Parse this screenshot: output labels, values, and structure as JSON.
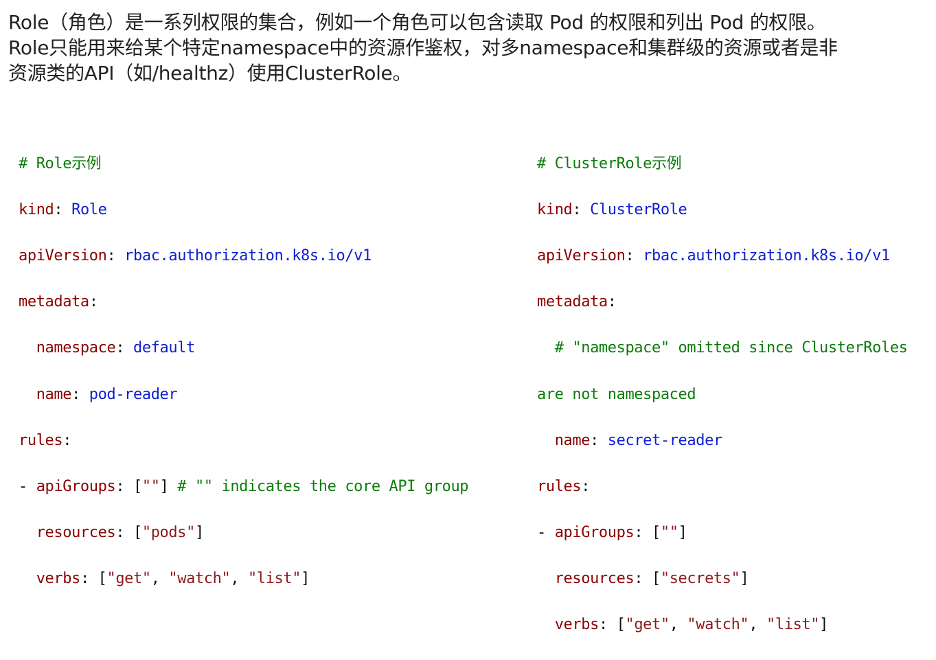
{
  "intro": {
    "line1": "Role（角色）是一系列权限的集合，例如一个角色可以包含读取 Pod 的权限和列出 Pod 的权限。",
    "line2": "Role只能用来给某个特定namespace中的资源作鉴权，对多namespace和集群级的资源或者是非",
    "line3": "资源类的API（如/healthz）使用ClusterRole。"
  },
  "role_example": {
    "comment": "# Role示例",
    "kind_key": "kind",
    "kind_val": "Role",
    "api_key": "apiVersion",
    "api_val": "rbac.authorization.k8s.io/v1",
    "meta_key": "metadata",
    "ns_key": "namespace",
    "ns_val": "default",
    "name_key": "name",
    "name_val": "pod-reader",
    "rules_key": "rules",
    "apigroups_key": "apiGroups",
    "apigroups_val": "\"\"",
    "apigroups_comment": "# \"\" indicates the core API group",
    "resources_key": "resources",
    "resources_val": "\"pods\"",
    "verbs_key": "verbs",
    "verbs": [
      "\"get\"",
      "\"watch\"",
      "\"list\""
    ]
  },
  "clusterrole_example": {
    "comment": "# ClusterRole示例",
    "kind_key": "kind",
    "kind_val": "ClusterRole",
    "api_key": "apiVersion",
    "api_val": "rbac.authorization.k8s.io/v1",
    "meta_key": "metadata",
    "ns_comment_1": "# \"namespace\" omitted since ClusterRoles",
    "ns_comment_2": "are not namespaced",
    "name_key": "name",
    "name_val": "secret-reader",
    "rules_key": "rules",
    "apigroups_key": "apiGroups",
    "apigroups_val": "\"\"",
    "resources_key": "resources",
    "resources_val": "\"secrets\"",
    "verbs_key": "verbs",
    "verbs": [
      "\"get\"",
      "\"watch\"",
      "\"list\""
    ]
  },
  "colors": {
    "comment": "#0a7c0a",
    "key": "#8b0000",
    "value": "#0d1fd4",
    "string": "#8b1a1a"
  }
}
